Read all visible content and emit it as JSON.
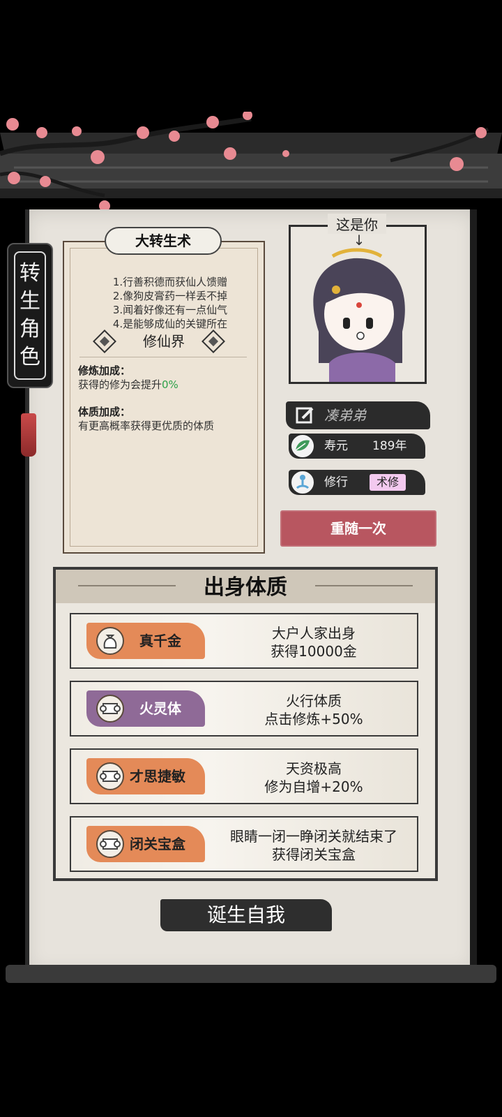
{
  "side_tag": {
    "line1": "转",
    "line2": "生",
    "line3": "角",
    "line4": "色"
  },
  "scroll": {
    "title": "大转生术",
    "description": [
      "1.行善积德而获仙人馈赠",
      "2.像狗皮膏药一样丢不掉",
      "3.闻着好像还有一点仙气",
      "4.是能够成仙的关键所在"
    ],
    "realm": "修仙界",
    "cultivation_bonus": {
      "title": "修炼加成：",
      "text": "获得的修为会提升",
      "value": "0%"
    },
    "physique_bonus": {
      "title": "体质加成：",
      "text": "有更高概率获得更优质的体质"
    }
  },
  "portrait": {
    "label": "这是你",
    "arrow": "↓"
  },
  "character": {
    "name": "凑弟弟",
    "lifespan_label": "寿元",
    "lifespan_value": "189年",
    "practice_label": "修行",
    "practice_value": "术修"
  },
  "reroll_button": "重随一次",
  "traits_panel": {
    "title": "出身体质",
    "items": [
      {
        "name": "真千金",
        "line1": "大户人家出身",
        "line2": "获得10000金",
        "style": "orange",
        "icon": "money-bag-icon"
      },
      {
        "name": "火灵体",
        "line1": "火行体质",
        "line2": "点击修炼+50%",
        "style": "purple",
        "icon": "scroll-icon"
      },
      {
        "name": "才思捷敏",
        "line1": "天资极高",
        "line2": "修为自增+20%",
        "style": "orange",
        "icon": "scroll-icon"
      },
      {
        "name": "闭关宝盒",
        "line1": "眼睛一闭一睁闭关就结束了",
        "line2": "获得闭关宝盒",
        "style": "orange",
        "icon": "scroll-icon"
      }
    ]
  },
  "birth_button": "诞生自我",
  "colors": {
    "accent_red": "#b85660",
    "badge_orange": "#e48a58",
    "badge_purple": "#8f6a97",
    "green": "#2da14a",
    "tag_pink": "#f3c9ef"
  }
}
